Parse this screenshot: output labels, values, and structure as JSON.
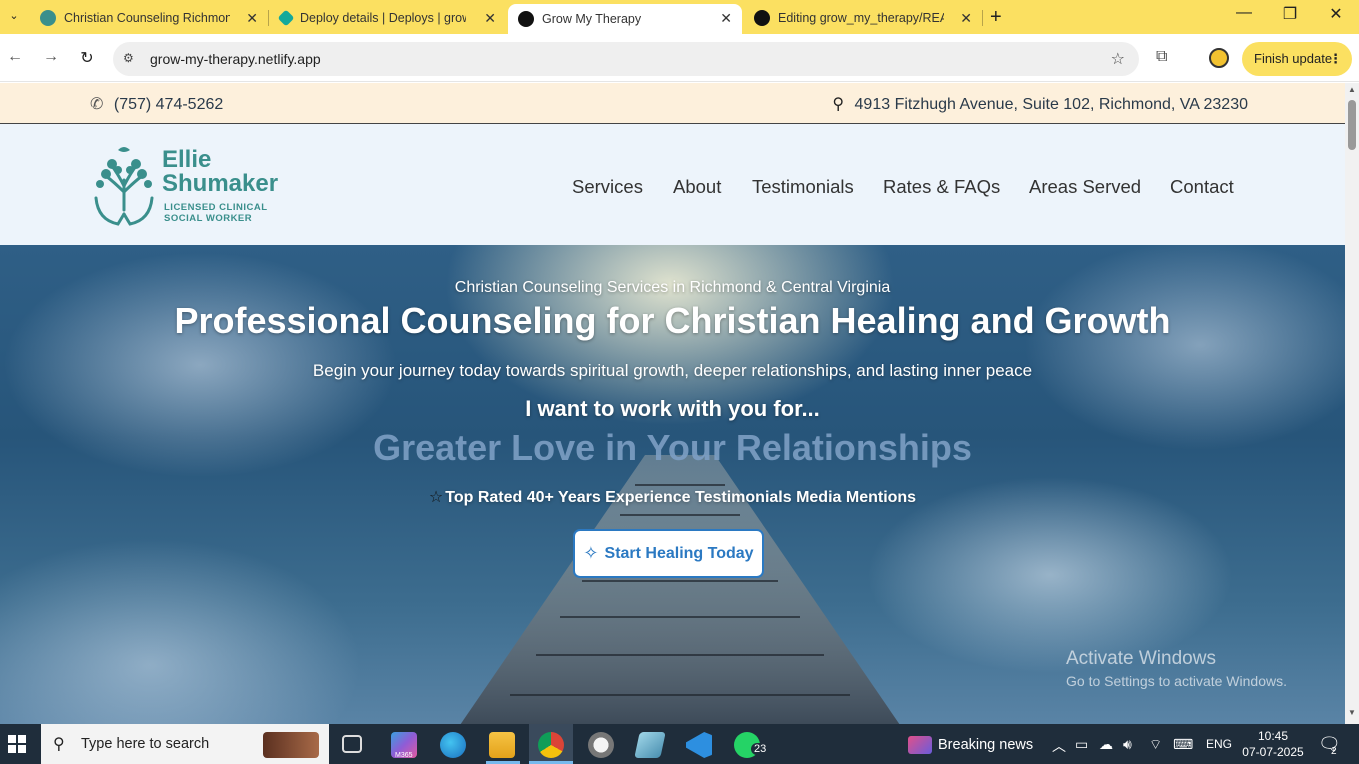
{
  "browser": {
    "tabs": [
      {
        "label": "Christian Counseling Richmond",
        "icon_color": "#3a8f8c"
      },
      {
        "label": "Deploy details | Deploys | grow",
        "icon_color": "#14a99b"
      },
      {
        "label": "Grow My Therapy",
        "icon_color": "#111111"
      },
      {
        "label": "Editing grow_my_therapy/READ",
        "icon_color": "#111111"
      }
    ],
    "active_tab_index": 2,
    "url": "grow-my-therapy.netlify.app",
    "finish_update_label": "Finish update",
    "accent": "#fbe061"
  },
  "site": {
    "topbar": {
      "phone": "(757) 474-5262",
      "address": "4913 Fitzhugh Avenue, Suite 102, Richmond, VA 23230"
    },
    "logo": {
      "name_line1": "Ellie",
      "name_line2": "Shumaker",
      "sub_line1": "LICENSED CLINICAL",
      "sub_line2": "SOCIAL WORKER",
      "color": "#3a8f8c"
    },
    "nav": [
      "Services",
      "About",
      "Testimonials",
      "Rates & FAQs",
      "Areas Served",
      "Contact"
    ],
    "hero": {
      "subtitle": "Christian Counseling Services in Richmond & Central Virginia",
      "title": "Professional Counseling for Christian Healing and Growth",
      "tagline": "Begin your journey today towards spiritual growth, deeper relationships, and lasting inner peace",
      "i_want": "I want to work with you for...",
      "rotating_text": "Greater Love in Your Relationships",
      "badges": "Top Rated 40+ Years Experience Testimonials Media Mentions",
      "cta_label": "Start Healing Today",
      "cta_color": "#2b79c2"
    },
    "watermark": {
      "line1": "Activate Windows",
      "line2": "Go to Settings to activate Windows."
    }
  },
  "taskbar": {
    "search_placeholder": "Type here to search",
    "whatsapp_badge": "23",
    "news_label": "Breaking news",
    "language": "ENG",
    "time": "10:45",
    "date": "07-07-2025",
    "notification_count": "2",
    "m365_label": "M365"
  }
}
